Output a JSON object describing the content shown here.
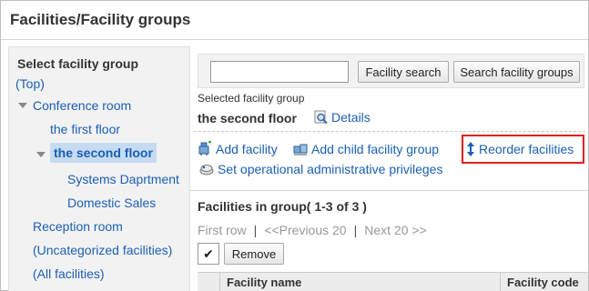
{
  "page": {
    "title": "Facilities/Facility groups"
  },
  "sidebar": {
    "heading": "Select facility group",
    "items": [
      {
        "label": "(Top)"
      },
      {
        "label": "Conference room"
      },
      {
        "label": "the first floor"
      },
      {
        "label": "the second floor"
      },
      {
        "label": "Systems Daprtment"
      },
      {
        "label": "Domestic Sales"
      },
      {
        "label": "Reception room"
      },
      {
        "label": "(Uncategorized facilities)"
      },
      {
        "label": "(All facilities)"
      }
    ]
  },
  "search": {
    "value": "",
    "placeholder": "",
    "facility_search_label": "Facility search",
    "group_search_label": "Search facility groups"
  },
  "selected_group": {
    "label": "Selected facility group",
    "value": "the second floor",
    "details_label": "Details"
  },
  "actions": {
    "add_facility": "Add facility",
    "add_child_group": "Add child facility group",
    "reorder": "Reorder facilities",
    "set_privileges": "Set operational administrative privileges"
  },
  "facilities": {
    "heading": "Facilities in group( 1-3 of 3 )",
    "pager": {
      "first": "First row",
      "sep": "|",
      "prev": "<<Previous 20",
      "next": "Next 20 >>"
    },
    "check_all": "✔",
    "remove_label": "Remove",
    "columns": [
      "Facility name",
      "Facility code"
    ]
  },
  "colors": {
    "link": "#1a5fb4",
    "highlight": "#c5dbf2",
    "emphasis_border": "#e02020"
  }
}
